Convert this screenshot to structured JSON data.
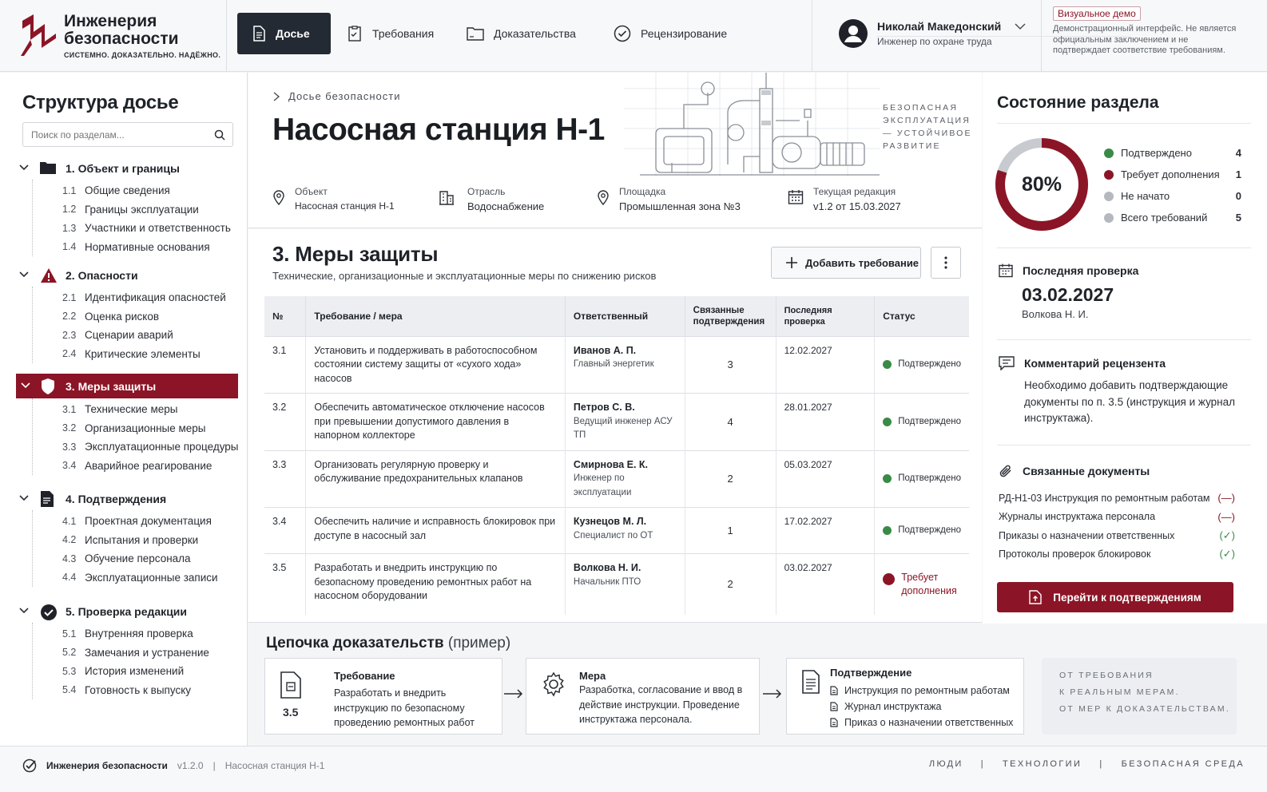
{
  "header": {
    "logo": {
      "line1": "Инженерия",
      "line2": "безопасности",
      "tagline": "СИСТЕМНО. ДОКАЗАТЕЛЬНО. НАДЁЖНО."
    },
    "tabs": [
      {
        "label": "Досье",
        "icon": "document-icon",
        "active": true
      },
      {
        "label": "Требования",
        "icon": "checklist-icon",
        "active": false
      },
      {
        "label": "Доказательства",
        "icon": "folder-icon",
        "active": false
      },
      {
        "label": "Рецензирование",
        "icon": "check-circle-icon",
        "active": false
      }
    ],
    "user": {
      "name": "Николай Македонский",
      "role": "Инженер по охране труда"
    },
    "demo": {
      "badge": "Визуальное демо",
      "text": "Демонстрационный интерфейс. Не является официальным заключением и не подтверждает соответствие требованиям."
    }
  },
  "sidebar": {
    "title": "Структура досье",
    "search_placeholder": "Поиск по разделам...",
    "sections": [
      {
        "label": "1. Объект и границы",
        "icon": "folder-icon",
        "items": [
          {
            "n": "1.1",
            "label": "Общие сведения"
          },
          {
            "n": "1.2",
            "label": "Границы эксплуатации"
          },
          {
            "n": "1.3",
            "label": "Участники и ответственность"
          },
          {
            "n": "1.4",
            "label": "Нормативные основания"
          }
        ]
      },
      {
        "label": "2. Опасности",
        "icon": "warning-icon",
        "items": [
          {
            "n": "2.1",
            "label": "Идентификация опасностей"
          },
          {
            "n": "2.2",
            "label": "Оценка рисков"
          },
          {
            "n": "2.3",
            "label": "Сценарии аварий"
          },
          {
            "n": "2.4",
            "label": "Критические элементы"
          }
        ]
      },
      {
        "label": "3. Меры защиты",
        "icon": "shield-icon",
        "active": true,
        "items": [
          {
            "n": "3.1",
            "label": "Технические меры"
          },
          {
            "n": "3.2",
            "label": "Организационные меры"
          },
          {
            "n": "3.3",
            "label": "Эксплуатационные процедуры"
          },
          {
            "n": "3.4",
            "label": "Аварийное реагирование"
          }
        ]
      },
      {
        "label": "4. Подтверждения",
        "icon": "document-icon",
        "items": [
          {
            "n": "4.1",
            "label": "Проектная документация"
          },
          {
            "n": "4.2",
            "label": "Испытания и проверки"
          },
          {
            "n": "4.3",
            "label": "Обучение персонала"
          },
          {
            "n": "4.4",
            "label": "Эксплуатационные записи"
          }
        ]
      },
      {
        "label": "5. Проверка редакции",
        "icon": "check-badge-icon",
        "items": [
          {
            "n": "5.1",
            "label": "Внутренняя проверка"
          },
          {
            "n": "5.2",
            "label": "Замечания и устранение"
          },
          {
            "n": "5.3",
            "label": "История изменений"
          },
          {
            "n": "5.4",
            "label": "Готовность к выпуску"
          }
        ]
      }
    ]
  },
  "hero": {
    "breadcrumb": "Досье безопасности",
    "title": "Насосная станция Н-1",
    "slogan": "БЕЗОПАСНАЯ ЭКСПЛУАТАЦИЯ — УСТОЙЧИВОЕ РАЗВИТИЕ",
    "meta": [
      {
        "key": "Объект",
        "value": "Насосная станция Н-1",
        "icon": "location-pin-icon"
      },
      {
        "key": "Отрасль",
        "value": "Водоснабжение",
        "icon": "building-icon"
      },
      {
        "key": "Площадка",
        "value": "Промышленная зона №3",
        "icon": "location-pin-icon"
      },
      {
        "key": "Текущая редакция",
        "value": "v1.2 от 15.03.2027",
        "icon": "calendar-icon"
      }
    ]
  },
  "measures": {
    "title": "3. Меры защиты",
    "subtitle": "Технические, организационные и эксплуатационные меры по снижению рисков",
    "add_button": "Добавить требование",
    "columns": [
      "№",
      "Требование / мера",
      "Ответственный",
      "Связанные подтверждения",
      "Последняя проверка",
      "Статус"
    ],
    "rows": [
      {
        "n": "3.1",
        "req": "Установить и поддерживать в работоспособном состоянии систему защиты от «сухого хода» насосов",
        "person": "Иванов А. П.",
        "role": "Главный энергетик",
        "links": "3",
        "date": "12.02.2027",
        "status": "Подтверждено",
        "ok": true
      },
      {
        "n": "3.2",
        "req": "Обеспечить автоматическое отключение насосов при превышении допустимого давления в напорном коллекторе",
        "person": "Петров С. В.",
        "role": "Ведущий инженер АСУ ТП",
        "links": "4",
        "date": "28.01.2027",
        "status": "Подтверждено",
        "ok": true
      },
      {
        "n": "3.3",
        "req": "Организовать регулярную проверку и обслуживание предохранительных клапанов",
        "person": "Смирнова Е. К.",
        "role": "Инженер по эксплуатации",
        "links": "2",
        "date": "05.03.2027",
        "status": "Подтверждено",
        "ok": true
      },
      {
        "n": "3.4",
        "req": "Обеспечить наличие и исправность блокировок при доступе в насосный зал",
        "person": "Кузнецов М. Л.",
        "role": "Специалист по ОТ",
        "links": "1",
        "date": "17.02.2027",
        "status": "Подтверждено",
        "ok": true
      },
      {
        "n": "3.5",
        "req": "Разработать и внедрить инструкцию по безопасному проведению ремонтных работ на насосном оборудовании",
        "person": "Волкова Н. И.",
        "role": "Начальник ПТО",
        "links": "2",
        "date": "03.02.2027",
        "status": "Требует дополнения",
        "ok": false
      }
    ]
  },
  "chain": {
    "title": "Цепочка доказательств",
    "title_suffix": "(пример)",
    "req": {
      "head": "Требование",
      "num": "3.5",
      "text": "Разработать и внедрить инструкцию по безопасному проведению ремонтных работ"
    },
    "measure": {
      "head": "Мера",
      "text": "Разработка, согласование и ввод в действие инструкции. Проведение инструктажа персонала."
    },
    "proof": {
      "head": "Подтверждение",
      "items": [
        "Инструкция по ремонтным работам",
        "Журнал инструктажа",
        "Приказ о назначении ответственных"
      ]
    },
    "note": [
      "ОТ ТРЕБОВАНИЯ",
      "К РЕАЛЬНЫМ МЕРАМ.",
      "ОТ МЕР К ДОКАЗАТЕЛЬСТВАМ."
    ]
  },
  "status": {
    "title": "Состояние раздела",
    "percent": "80%",
    "progress": 0.8,
    "legend": [
      {
        "label": "Подтверждено",
        "count": "4",
        "color": "#3a8a47"
      },
      {
        "label": "Требует дополнения",
        "count": "1",
        "color": "#8b1526"
      },
      {
        "label": "Не начато",
        "count": "0",
        "color": "#b5b9bf"
      },
      {
        "label": "Всего требований",
        "count": "5",
        "color": "#b5b9bf"
      }
    ],
    "last_check": {
      "title": "Последняя проверка",
      "date": "03.02.2027",
      "by": "Волкова Н. И."
    },
    "comment": {
      "title": "Комментарий рецензента",
      "text": "Необходимо добавить подтверждающие документы по п. 3.5 (инструкция и журнал инструктажа)."
    },
    "docs": {
      "title": "Связанные документы",
      "items": [
        {
          "label": "РД-Н1-03 Инструкция по ремонтным работам",
          "mark": "(—)",
          "ok": false
        },
        {
          "label": "Журналы инструктажа персонала",
          "mark": "(—)",
          "ok": false
        },
        {
          "label": "Приказы о назначении ответственных",
          "mark": "(✓)",
          "ok": true
        },
        {
          "label": "Протоколы проверок блокировок",
          "mark": "(✓)",
          "ok": true
        }
      ]
    },
    "go_button": "Перейти к подтверждениям"
  },
  "footer": {
    "brand": "Инженерия безопасности",
    "version": "v1.2.0",
    "object": "Насосная станция Н-1",
    "right": [
      "ЛЮДИ",
      "|",
      "ТЕХНОЛОГИИ",
      "|",
      "БЕЗОПАСНАЯ СРЕДА"
    ]
  },
  "colors": {
    "accent": "#8b1526",
    "dark": "#232a33",
    "success": "#3a8a47",
    "muted": "#b5b9bf"
  }
}
